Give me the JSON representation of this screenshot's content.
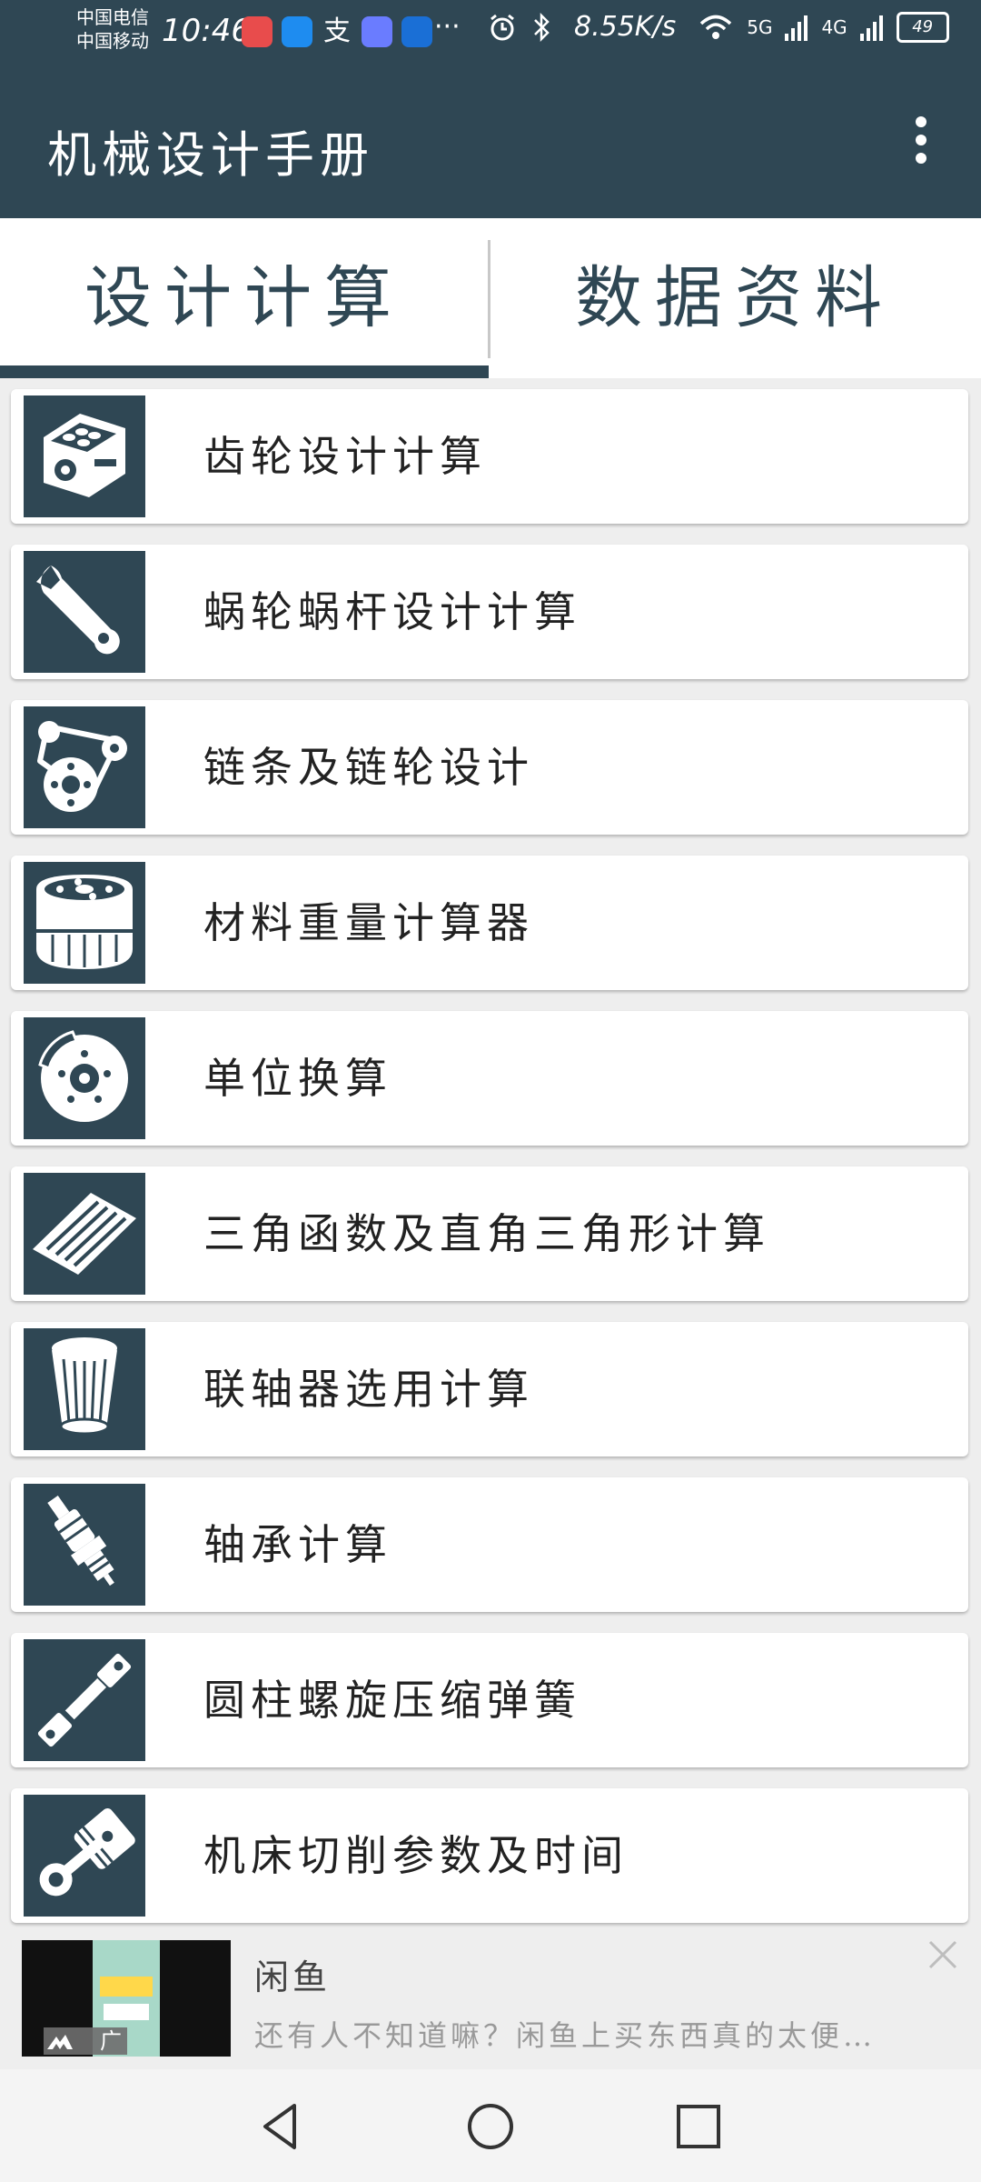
{
  "status_bar": {
    "carrier_1": "中国电信",
    "carrier_2": "中国移动",
    "time": "10:46",
    "more_indicator": "···",
    "net_speed": "8.55K/s",
    "signal_1": "5G",
    "signal_2": "4G",
    "battery": "49",
    "icons": [
      "huawei-store-icon",
      "browser-icon",
      "alipay-icon",
      "music-icon",
      "bot-icon",
      "alarm-icon",
      "bluetooth-icon",
      "wifi-icon"
    ]
  },
  "app_bar": {
    "title": "机械设计手册",
    "menu_icon": "more-vert-icon"
  },
  "tabs": [
    {
      "label": "设计计算",
      "selected": true
    },
    {
      "label": "数据资料",
      "selected": false
    }
  ],
  "list": {
    "items": [
      {
        "label": "齿轮设计计算",
        "icon": "engine-block-icon"
      },
      {
        "label": "蜗轮蜗杆设计计算",
        "icon": "wrench-icon"
      },
      {
        "label": "链条及链轮设计",
        "icon": "belt-pulley-icon"
      },
      {
        "label": "材料重量计算器",
        "icon": "oil-filter-icon"
      },
      {
        "label": "单位换算",
        "icon": "brake-disc-icon"
      },
      {
        "label": "三角函数及直角三角形计算",
        "icon": "air-filter-icon"
      },
      {
        "label": "联轴器选用计算",
        "icon": "cone-filter-icon"
      },
      {
        "label": "轴承计算",
        "icon": "spark-plug-icon"
      },
      {
        "label": "圆柱螺旋压缩弹簧",
        "icon": "drive-shaft-icon"
      },
      {
        "label": "机床切削参数及时间",
        "icon": "piston-icon"
      }
    ]
  },
  "ad": {
    "title": "闲鱼",
    "description": "还有人不知道嘛？闲鱼上买东西真的太便…",
    "badge": "广告",
    "close_icon": "close-icon"
  },
  "nav_bar": {
    "icons": [
      "back-triangle-icon",
      "home-circle-icon",
      "recents-square-icon"
    ]
  },
  "colors": {
    "primary": "#2f4754",
    "background": "#eeeeee"
  }
}
